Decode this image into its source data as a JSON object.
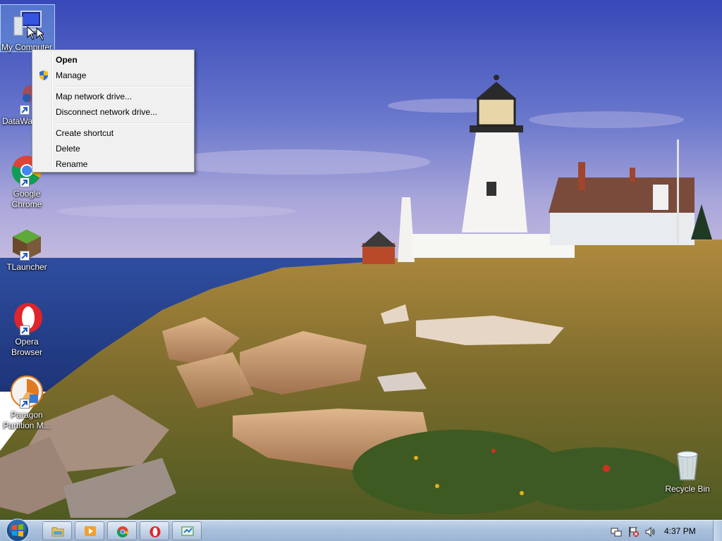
{
  "desktop": {
    "icons": [
      {
        "name": "My Computer",
        "label": "My Computer",
        "icon": "computer-icon",
        "selected": true
      },
      {
        "name": "DataWa",
        "label": "DataWa",
        "icon": "datawarehouse-icon"
      },
      {
        "name": "Google Chrome",
        "label": "Google Chrome",
        "icon": "chrome-icon"
      },
      {
        "name": "TLauncher",
        "label": "TLauncher",
        "icon": "tlauncher-icon"
      },
      {
        "name": "Opera Browser",
        "label": "Opera Browser",
        "icon": "opera-icon"
      },
      {
        "name": "Paragon Partition M...",
        "label": "Paragon Partition M...",
        "icon": "paragon-icon"
      },
      {
        "name": "Recycle Bin",
        "label": "Recycle Bin",
        "icon": "recycle-bin-icon"
      }
    ]
  },
  "context_menu": {
    "items": [
      {
        "label": "Open",
        "bold": true
      },
      {
        "label": "Manage",
        "icon": "uac-shield-icon"
      },
      {
        "label": "Map network drive..."
      },
      {
        "label": "Disconnect network drive..."
      },
      {
        "label": "Create shortcut"
      },
      {
        "label": "Delete"
      },
      {
        "label": "Rename"
      }
    ]
  },
  "taskbar": {
    "start": "windows-start-orb-icon",
    "pinned": [
      {
        "name": "Windows Explorer",
        "icon": "folder-icon"
      },
      {
        "name": "Windows Media Player",
        "icon": "media-player-icon"
      },
      {
        "name": "Google Chrome",
        "icon": "chrome-icon"
      },
      {
        "name": "Opera",
        "icon": "opera-icon"
      },
      {
        "name": "Paragon",
        "icon": "paragon-task-icon"
      }
    ],
    "tray": [
      "network-icon",
      "action-center-flag-icon",
      "volume-icon"
    ],
    "clock": "4:37 PM"
  },
  "colors": {
    "menu_bg": "#f0f0f0",
    "taskbar": "#a9c0dc",
    "sky": "#4a5fc4",
    "grass": "#8a7a3a"
  }
}
